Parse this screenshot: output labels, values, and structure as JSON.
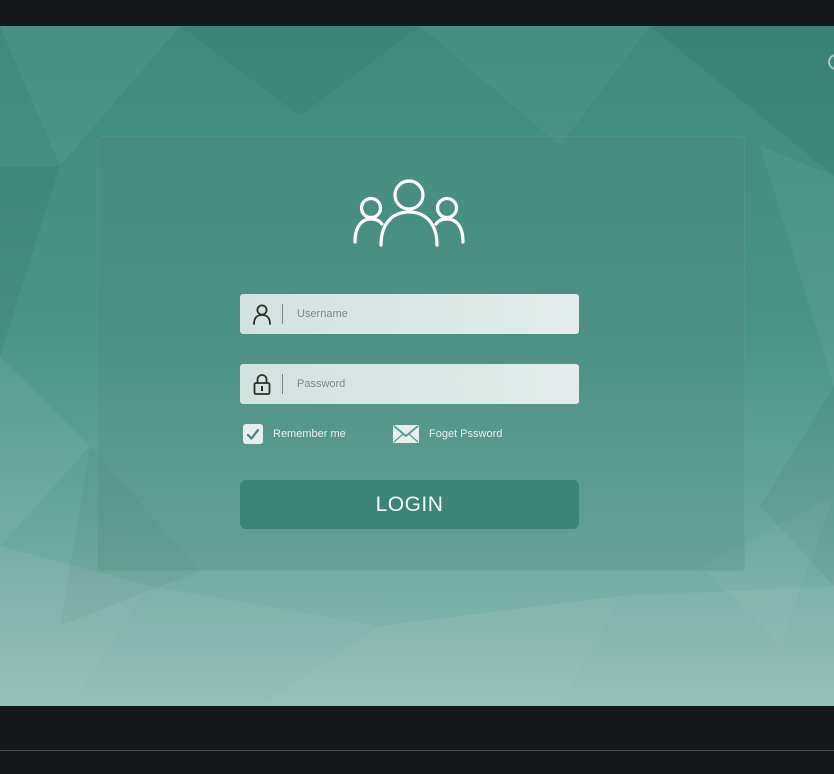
{
  "login_form": {
    "username_placeholder": "Username",
    "password_placeholder": "Password",
    "remember_label": "Remember me",
    "forget_label": "Foget Pssword",
    "login_label": "LOGIN"
  },
  "icons": {
    "users": "users-group-icon",
    "user": "user-icon",
    "lock": "lock-icon",
    "check": "checkmark-icon",
    "mail": "envelope-icon"
  },
  "colors": {
    "background": "#4a9487",
    "panel": "#5a9d90",
    "field": "#dde8e6",
    "button": "#3d8478",
    "frame": "#16171b"
  }
}
